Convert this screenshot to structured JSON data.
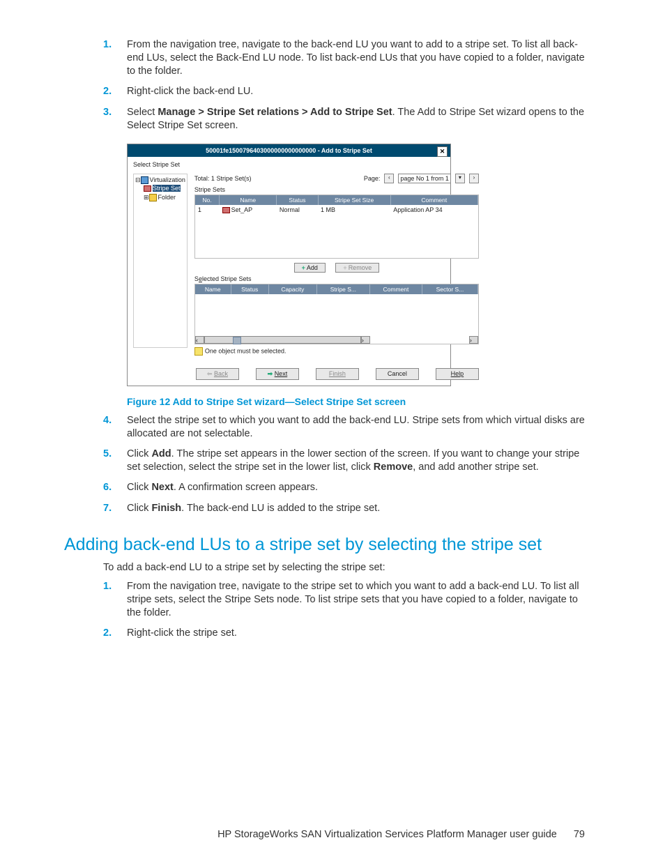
{
  "steps_a": [
    {
      "n": "1.",
      "t": "From the navigation tree, navigate to the back-end LU you want to add to a stripe set. To list all back-end LUs, select the Back-End LU node. To list back-end LUs that you have copied to a folder, navigate to the folder."
    },
    {
      "n": "2.",
      "t": "Right-click the back-end LU."
    },
    {
      "n": "3.",
      "pre": "Select ",
      "bold1": "Manage > Stripe Set relations > Add to Stripe Set",
      "post": ". The Add to Stripe Set wizard opens to the Select Stripe Set screen."
    }
  ],
  "figure_caption": "Figure 12 Add to Stripe Set wizard—Select Stripe Set screen",
  "steps_b": [
    {
      "n": "4.",
      "t": "Select the stripe set to which you want to add the back-end LU. Stripe sets from which virtual disks are allocated are not selectable."
    },
    {
      "n": "5.",
      "pre": "Click ",
      "bold1": "Add",
      "mid": ". The stripe set appears in the lower section of the screen. If you want to change your stripe set selection, select the stripe set in the lower list, click ",
      "bold2": "Remove",
      "post": ", and add another stripe set."
    },
    {
      "n": "6.",
      "pre": "Click ",
      "bold1": "Next",
      "post": ". A confirmation screen appears."
    },
    {
      "n": "7.",
      "pre": "Click ",
      "bold1": "Finish",
      "post": ". The back-end LU is added to the stripe set."
    }
  ],
  "section_title": "Adding back-end LUs to a stripe set by selecting the stripe set",
  "intro": "To add a back-end LU to a stripe set by selecting the stripe set:",
  "steps_c": [
    {
      "n": "1.",
      "t": "From the navigation tree, navigate to the stripe set to which you want to add a back-end LU. To list all stripe sets, select the Stripe Sets node. To list stripe sets that you have copied to a folder, navigate to the folder."
    },
    {
      "n": "2.",
      "t": "Right-click the stripe set."
    }
  ],
  "footer": {
    "title": "HP StorageWorks SAN Virtualization Services Platform Manager user guide",
    "page": "79"
  },
  "wizard": {
    "title": "50001fe1500796403000000000000000 - Add to Stripe Set",
    "step_label": "Select Stripe Set",
    "tree": {
      "n1": "Virtualization",
      "n2": "Stripe Set",
      "n3": "Folder"
    },
    "total": "Total: 1 Stripe Set(s)",
    "page_label": "Page:",
    "page_value": "page No 1 from 1",
    "stripe_sets_label": "Stripe Sets",
    "th1": [
      "No.",
      "Name",
      "Status",
      "Stripe Set Size",
      "Comment"
    ],
    "row1": {
      "no": "1",
      "name": "Set_AP",
      "status": "Normal",
      "size": "1 MB",
      "comment": "Application AP 34"
    },
    "add_btn": "Add",
    "remove_btn": "Remove",
    "selected_label": "Selected Stripe Sets",
    "th2": [
      "Name",
      "Status",
      "Capacity",
      "Stripe S...",
      "Comment",
      "Sector S..."
    ],
    "msg": "One object must be selected.",
    "back": "Back",
    "next": "Next",
    "finish": "Finish",
    "cancel": "Cancel",
    "help": "Help"
  }
}
